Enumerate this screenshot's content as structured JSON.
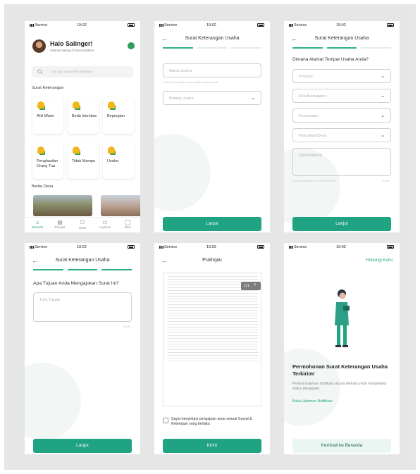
{
  "status_bar": {
    "carrier": "Service",
    "time": "19:02"
  },
  "home": {
    "greeting": "Halo Salinger!",
    "subtitle": "Selamat datang di Desa Kaliderex",
    "search_placeholder": "Cari apa yang Anda butuhkan",
    "section_title": "Surat Keterangan",
    "cards": [
      "Ahli Waris",
      "Beda Identitas",
      "Bepergian",
      "Penghasilan Orang Tua",
      "Tidak Mampu",
      "Usaha"
    ],
    "news_title": "Berita Desa",
    "nav": [
      "Beranda",
      "Riwayat",
      "Desa",
      "Layanan",
      "Akun"
    ]
  },
  "step1": {
    "title": "Surat Keterangan Usaha",
    "name_placeholder": "Nama Usaha",
    "name_hint": "Contoh: penulisan nama usaha sudah benar",
    "field_placeholder": "Bidang Usaha",
    "button": "Lanjut"
  },
  "step2": {
    "title": "Surat Keterangan Usaha",
    "question": "Dimana Alamat Tempat Usaha Anda?",
    "selects": [
      "Provinsi",
      "Kota/Kabupaten",
      "Kecamatan",
      "Kelurahan/Desa"
    ],
    "address_placeholder": "Detail Alamat",
    "address_hint": "Contoh: Blok A no. 1, RT 01/RW 01",
    "counter": "0/250",
    "button": "Lanjut"
  },
  "step3": {
    "title": "Surat Keterangan Usaha",
    "question": "Apa Tujuan Anda Mengajukan Surat Ini?",
    "placeholder": "Tulis Tujuan",
    "counter": "0/250",
    "button": "Lanjut"
  },
  "preview": {
    "title": "Pratinjau",
    "page_indicator": "1/1",
    "agreement": "Saya menyetujui pengajuan surat sesuai Syarat & Ketentuan yang berlaku",
    "button": "Kirim"
  },
  "success": {
    "contact_link": "Hubungi Kami",
    "heading": "Permohonan Surat Keterangan Usaha Terkirim!",
    "body": "Periksa halaman notifikasi secara berkala untuk mengetahui status pengajuan.",
    "link": "Buka Halaman Notifikasi",
    "button": "Kembali ke Beranda"
  },
  "colors": {
    "primary": "#1fa383",
    "background": "#e6e6e6",
    "card": "#ffffff"
  }
}
